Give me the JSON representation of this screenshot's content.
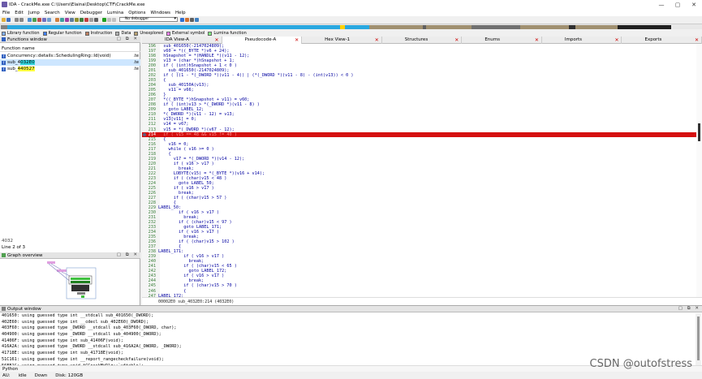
{
  "window": {
    "title": "IDA - CrackMe.exe C:\\Users\\Elaina\\Desktop\\CTF\\CrackMe.exe",
    "min": "—",
    "max": "▢",
    "close": "✕"
  },
  "menu": [
    "File",
    "Edit",
    "Jump",
    "Search",
    "View",
    "Debugger",
    "Lumina",
    "Options",
    "Windows",
    "Help"
  ],
  "toolbar": {
    "debugger_select": "No debugger"
  },
  "legend": [
    {
      "label": "Library function",
      "color": "#7fb0ff"
    },
    {
      "label": "Regular function",
      "color": "#4080ff"
    },
    {
      "label": "Instruction",
      "color": "#c08060"
    },
    {
      "label": "Data",
      "color": "#b0b0b0"
    },
    {
      "label": "Unexplored",
      "color": "#b8a070"
    },
    {
      "label": "External symbol",
      "color": "#ff80ff"
    },
    {
      "label": "Lumina function",
      "color": "#80ff80"
    }
  ],
  "functions_window": {
    "title": "Functions window",
    "column": "Function name",
    "rows": [
      {
        "name": "Concurrency::details::SchedulingRing::Id(void)",
        "seg": ".te",
        "hl": ""
      },
      {
        "name_pre": "sub_4",
        "name_hl": "032E0",
        "seg": ".te",
        "hl": "c"
      },
      {
        "name_pre": "sub_",
        "name_hl": "440527",
        "seg": ".te",
        "hl": "y"
      }
    ],
    "search": "4032",
    "line_info": "Line 2 of 3"
  },
  "graph_overview": {
    "title": "Graph overview"
  },
  "tabs": [
    {
      "label": "IDA View-A",
      "active": false
    },
    {
      "label": "Pseudocode-A",
      "active": true
    },
    {
      "label": "Hex View-1",
      "active": false
    },
    {
      "label": "Structures",
      "active": false
    },
    {
      "label": "Enums",
      "active": false
    },
    {
      "label": "Imports",
      "active": false
    },
    {
      "label": "Exports",
      "active": false
    }
  ],
  "code_lines": [
    {
      "n": "196",
      "t": "  sub_401650(-2147024809);"
    },
    {
      "n": "197",
      "t": "  v60 = *((_BYTE *)v6 + 24);"
    },
    {
      "n": "198",
      "t": "  hSnapshot = *(HANDLE *)(v11 - 12);"
    },
    {
      "n": "199",
      "t": "  v13 = (char *)hSnapshot + 1;"
    },
    {
      "n": "200",
      "t": "  if ( (int)hSnapshot + 1 < 0 )"
    },
    {
      "n": "201",
      "t": "    sub_401650(-2147024809);"
    },
    {
      "n": "202",
      "t": "  if ( ((1 - *(_DWORD *)(v11 - 4)) | (*(_DWORD *)(v11 - 8) - (int)v13)) < 0 )"
    },
    {
      "n": "203",
      "t": "  {"
    },
    {
      "n": "204",
      "t": "    sub_40150A(v13);"
    },
    {
      "n": "205",
      "t": "    v11 = v66;"
    },
    {
      "n": "206",
      "t": "  }"
    },
    {
      "n": "207",
      "t": "  *((_BYTE *)hSnapshot + v11) = v60;"
    },
    {
      "n": "208",
      "t": "  if ( (int)v13 > *(_DWORD *)(v11 - 8) )"
    },
    {
      "n": "209",
      "t": "    goto LABEL_12;"
    },
    {
      "n": "210",
      "t": "  *(_DWORD *)(v11 - 12) = v13;"
    },
    {
      "n": "211",
      "t": "  v13[v11] = 0;"
    },
    {
      "n": "212",
      "t": "  v14 = v67;"
    },
    {
      "n": "213",
      "t": "  v15 = *(_DWORD *)(v67 - 12);"
    },
    {
      "n": "214",
      "t": "  if ( v15 == 48 && v15 != 40 )",
      "bp": true
    },
    {
      "n": "215",
      "t": "  {"
    },
    {
      "n": "216",
      "t": "    v16 = 0;"
    },
    {
      "n": "217",
      "t": "    while ( v16 >= 0 )"
    },
    {
      "n": "218",
      "t": "    {"
    },
    {
      "n": "219",
      "t": "      v17 = *(_DWORD *)(v14 - 12);"
    },
    {
      "n": "220",
      "t": "      if ( v16 > v17 )"
    },
    {
      "n": "221",
      "t": "        break;"
    },
    {
      "n": "222",
      "t": "      LOBYTE(v15) = *(_BYTE *)(v16 + v14);"
    },
    {
      "n": "223",
      "t": "      if ( (char)v15 < 48 )"
    },
    {
      "n": "224",
      "t": "        goto LABEL_50;"
    },
    {
      "n": "225",
      "t": "      if ( v16 > v17 )"
    },
    {
      "n": "226",
      "t": "        break;"
    },
    {
      "n": "227",
      "t": "      if ( (char)v15 > 57 )"
    },
    {
      "n": "228",
      "t": "      {"
    },
    {
      "n": "229",
      "t": "LABEL_50:"
    },
    {
      "n": "230",
      "t": "        if ( v16 > v17 )"
    },
    {
      "n": "231",
      "t": "          break;"
    },
    {
      "n": "232",
      "t": "        if ( (char)v15 < 97 )"
    },
    {
      "n": "233",
      "t": "          goto LABEL_171;"
    },
    {
      "n": "234",
      "t": "        if ( v16 > v17 )"
    },
    {
      "n": "235",
      "t": "          break;"
    },
    {
      "n": "236",
      "t": "        if ( (char)v15 > 102 )"
    },
    {
      "n": "237",
      "t": "        {"
    },
    {
      "n": "238",
      "t": "LABEL_171:"
    },
    {
      "n": "239",
      "t": "          if ( v16 > v17 )"
    },
    {
      "n": "240",
      "t": "            break;"
    },
    {
      "n": "241",
      "t": "          if ( (char)v15 < 65 )"
    },
    {
      "n": "242",
      "t": "            goto LABEL_172;"
    },
    {
      "n": "243",
      "t": "          if ( v16 > v17 )"
    },
    {
      "n": "244",
      "t": "            break;"
    },
    {
      "n": "245",
      "t": "          if ( (char)v15 > 70 )"
    },
    {
      "n": "246",
      "t": "          {"
    },
    {
      "n": "247",
      "t": "LABEL_172:"
    }
  ],
  "code_status": "00002E0 sub_4032E0:214 (4032E0)",
  "output": {
    "title": "Output window",
    "lines": [
      "401650: using guessed type int __stdcall sub_401650(_DWORD);",
      "402E60: using guessed type int __cdecl sub_402E60(_DWORD);",
      "403F60: using guessed type _DWORD __stdcall sub_403F60(_DWORD, char);",
      "404900: using guessed type _DWORD __stdcall sub_404900(_DWORD);",
      "41406F: using guessed type int sub_41406F(void);",
      "416A2A: using guessed type _DWORD __stdcall sub_416A2A(_DWORD, _DWORD);",
      "41718E: using guessed type int sub_41718E(void);",
      "51C161: using guessed type int __report_rangecheckfailure(void);",
      "56FE1C: using guessed type void *CCrackMeDlg::`vftable';"
    ]
  },
  "python_label": "Python",
  "status": [
    "AU:",
    "idle",
    "Down",
    "Disk: 120GB"
  ],
  "watermark": "CSDN @outofstress"
}
